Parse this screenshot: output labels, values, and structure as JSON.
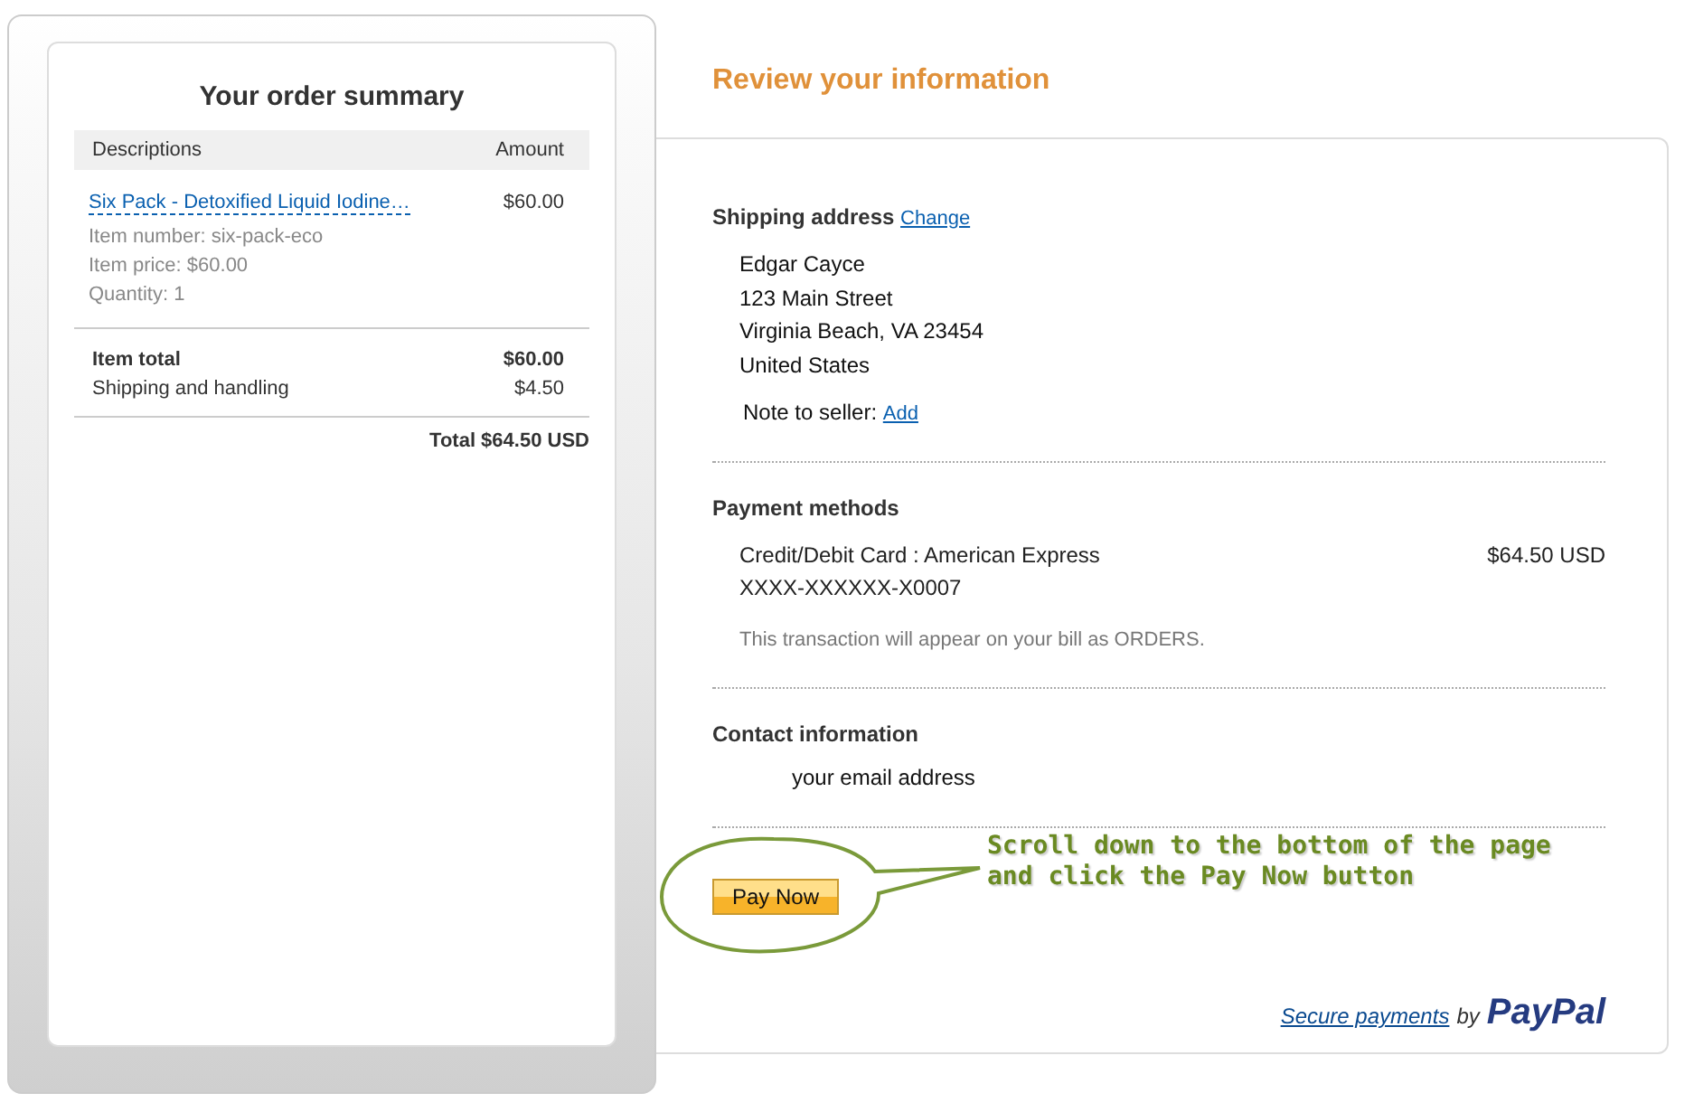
{
  "order_summary": {
    "title": "Your order summary",
    "columns": [
      "Descriptions",
      "Amount"
    ],
    "item": {
      "name": "Six Pack - Detoxified Liquid Iodine…",
      "amount": "$60.00",
      "details": [
        "Item number: six-pack-eco",
        "Item price: $60.00",
        "Quantity: 1"
      ]
    },
    "totals": [
      {
        "label": "Item total",
        "value": "$60.00",
        "bold": true
      },
      {
        "label": "Shipping and handling",
        "value": "$4.50",
        "bold": false
      }
    ],
    "total": "Total $64.50 USD"
  },
  "review": {
    "title": "Review your information",
    "shipping": {
      "heading": "Shipping address",
      "change_link": "Change",
      "lines": [
        "Edgar Cayce",
        "123 Main Street",
        "Virginia Beach, VA 23454",
        "United States"
      ],
      "note_label": "Note to seller:",
      "note_link": "Add"
    },
    "payment": {
      "heading": "Payment methods",
      "method": "Credit/Debit Card : American Express",
      "amount": "$64.50 USD",
      "card_number": "XXXX-XXXXXX-X0007",
      "notice": "This transaction will appear on your bill as ORDERS."
    },
    "contact": {
      "heading": "Contact information",
      "email": "your email address"
    },
    "pay_button": "Pay Now",
    "callout": "Scroll down to the bottom of the page\nand click the Pay Now button",
    "footer": {
      "link": "Secure payments",
      "by": "by",
      "logo": "PayPal"
    }
  }
}
